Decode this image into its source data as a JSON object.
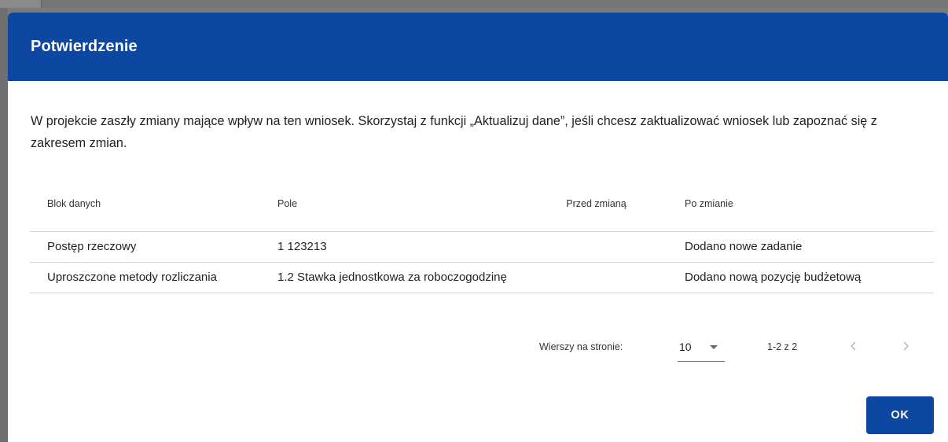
{
  "dialog": {
    "title": "Potwierdzenie",
    "message": "W projekcie zaszły zmiany mające wpływ na ten wniosek. Skorzystaj z funkcji „Aktualizuj dane”, jeśli chcesz zaktualizować wniosek lub zapoznać się z zakresem zmian.",
    "ok_label": "OK"
  },
  "table": {
    "headers": [
      "Blok danych",
      "Pole",
      "Przed zmianą",
      "Po zmianie"
    ],
    "rows": [
      [
        "Postęp rzeczowy",
        "1 123213",
        "",
        "Dodano nowe zadanie"
      ],
      [
        "Uproszczone metody rozliczania",
        "1.2 Stawka jednostkowa za roboczogodzinę",
        "",
        "Dodano nową pozycję budżetową"
      ]
    ]
  },
  "pagination": {
    "rows_per_page_label": "Wierszy na stronie:",
    "rows_per_page_value": "10",
    "range": "1-2 z 2"
  },
  "icons": {
    "prev": "chevron-left-icon",
    "next": "chevron-right-icon",
    "dropdown": "caret-down-icon"
  },
  "colors": {
    "primary": "#0c47a1",
    "overlay": "#7a7a7a"
  }
}
